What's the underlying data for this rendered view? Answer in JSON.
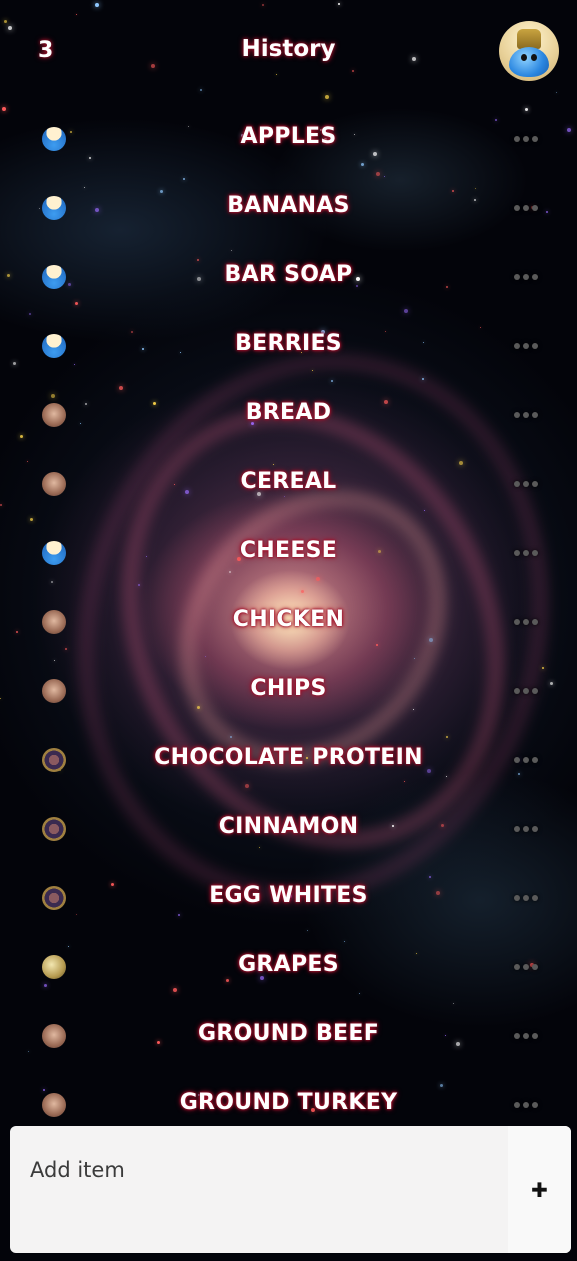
{
  "header": {
    "count": "3",
    "title": "History",
    "avatar_icon": "slime-avatar-icon"
  },
  "items": [
    {
      "label": "APPLES",
      "avatar": "av-slime"
    },
    {
      "label": "BANANAS",
      "avatar": "av-slime"
    },
    {
      "label": "BAR SOAP",
      "avatar": "av-slime"
    },
    {
      "label": "BERRIES",
      "avatar": "av-slime"
    },
    {
      "label": "BREAD",
      "avatar": "av-face"
    },
    {
      "label": "CEREAL",
      "avatar": "av-face"
    },
    {
      "label": "CHEESE",
      "avatar": "av-slime"
    },
    {
      "label": "CHICKEN",
      "avatar": "av-face"
    },
    {
      "label": "CHIPS",
      "avatar": "av-face"
    },
    {
      "label": "CHOCOLATE PROTEIN",
      "avatar": "av-pattern"
    },
    {
      "label": "CINNAMON",
      "avatar": "av-pattern"
    },
    {
      "label": "EGG WHITES",
      "avatar": "av-pattern"
    },
    {
      "label": "GRAPES",
      "avatar": "av-gold"
    },
    {
      "label": "GROUND BEEF",
      "avatar": "av-face"
    },
    {
      "label": "GROUND TURKEY",
      "avatar": "av-face"
    }
  ],
  "add_item": {
    "placeholder": "Add item",
    "button_icon": "✚"
  },
  "colors": {
    "text_glow": "#a0102a",
    "input_bg": "#f4f3f3"
  }
}
